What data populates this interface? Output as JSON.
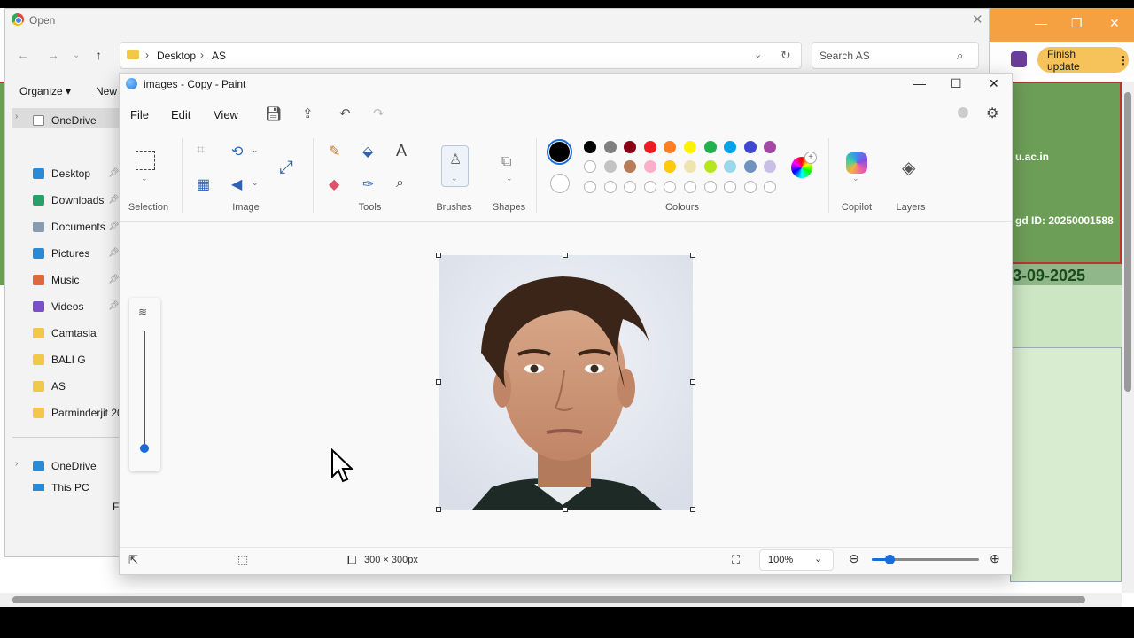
{
  "open_dialog": {
    "title": "Open",
    "breadcrumb": [
      "Desktop",
      "AS"
    ],
    "search_placeholder": "Search AS",
    "organize_label": "Organize",
    "new_label": "New",
    "filename_label": "F",
    "nav_items": [
      {
        "label": "OneDrive",
        "icon": "file-icon",
        "color": "#ffffff",
        "pinned": false
      },
      {
        "label": "Desktop",
        "icon": "desktop-icon",
        "color": "#2b8ad6",
        "pinned": true
      },
      {
        "label": "Downloads",
        "icon": "download-icon",
        "color": "#28a06a",
        "pinned": true
      },
      {
        "label": "Documents",
        "icon": "document-icon",
        "color": "#8a9bb0",
        "pinned": true
      },
      {
        "label": "Pictures",
        "icon": "picture-icon",
        "color": "#2b8ad6",
        "pinned": true
      },
      {
        "label": "Music",
        "icon": "music-icon",
        "color": "#e0673a",
        "pinned": true
      },
      {
        "label": "Videos",
        "icon": "video-icon",
        "color": "#7b4fc9",
        "pinned": true
      },
      {
        "label": "Camtasia",
        "icon": "folder-icon",
        "color": "#f2c84b",
        "pinned": false
      },
      {
        "label": "BALI G",
        "icon": "folder-icon",
        "color": "#f2c84b",
        "pinned": false
      },
      {
        "label": "AS",
        "icon": "folder-icon",
        "color": "#f2c84b",
        "pinned": false
      },
      {
        "label": "Parminderjit 20",
        "icon": "folder-icon",
        "color": "#f2c84b",
        "pinned": false
      },
      {
        "label": "OneDrive",
        "icon": "cloud-icon",
        "color": "#2b8ad6",
        "pinned": false
      },
      {
        "label": "This PC",
        "icon": "pc-icon",
        "color": "#2b8ad6",
        "pinned": false
      }
    ]
  },
  "browser": {
    "finish_update_label": "Finish update",
    "page_url_text": "u.ac.in",
    "page_id_text": "gd ID: 20250001588",
    "page_date_text": "3-09-2025",
    "accent": "#f5a142"
  },
  "paint": {
    "title": "images - Copy - Paint",
    "menu": [
      "File",
      "Edit",
      "View"
    ],
    "groups": {
      "selection": "Selection",
      "image": "Image",
      "tools": "Tools",
      "brushes": "Brushes",
      "shapes": "Shapes",
      "colours": "Colours",
      "copilot": "Copilot",
      "layers": "Layers"
    },
    "palette_row1": [
      "#000000",
      "#7f7f7f",
      "#880015",
      "#ed1c24",
      "#ff7f27",
      "#fff200",
      "#22b14c",
      "#00a2e8",
      "#3f48cc",
      "#a349a4"
    ],
    "palette_row2": [
      "#ffffff",
      "#c3c3c3",
      "#b97a57",
      "#ffaec9",
      "#ffc90e",
      "#efe4b0",
      "#b5e61d",
      "#99d9ea",
      "#7092be",
      "#c8bfe7"
    ],
    "palette_row3_count": 10,
    "primary_color": "#000000",
    "secondary_color": "#ffffff",
    "status": {
      "canvas_size": "300 × 300px",
      "zoom": "100%"
    }
  }
}
